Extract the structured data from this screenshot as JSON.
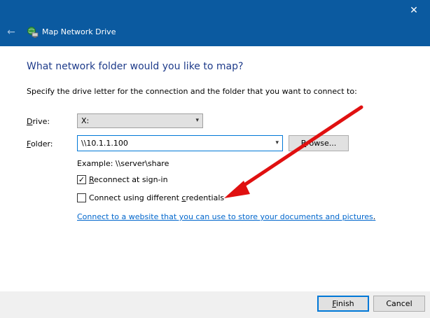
{
  "window": {
    "title": "Map Network Drive",
    "close_glyph": "✕",
    "back_glyph": "←"
  },
  "main": {
    "heading": "What network folder would you like to map?",
    "instruction": "Specify the drive letter for the connection and the folder that you want to connect to:",
    "drive": {
      "label_u": "D",
      "label_rest": "rive:",
      "value": "X:"
    },
    "folder": {
      "label_u": "F",
      "label_prefix": "",
      "label_rest": "older:",
      "value": "\\\\10.1.1.100"
    },
    "browse": {
      "label_u": "B",
      "label_rest": "rowse..."
    },
    "example": "Example: \\\\server\\share",
    "reconnect": {
      "checked": true,
      "label_u": "R",
      "label_rest": "econnect at sign-in"
    },
    "credentials": {
      "checked": false,
      "label_pre": "Connect using different ",
      "label_u": "c",
      "label_rest": "redentials"
    },
    "link": {
      "text": "Connect to a website that you can use to store your documents and pictures",
      "dot": "."
    }
  },
  "footer": {
    "finish_u": "F",
    "finish_rest": "inish",
    "cancel": "Cancel"
  },
  "colors": {
    "titlebar": "#0b5aa0",
    "heading": "#1e3b8a",
    "link": "#0066cc",
    "annotation_arrow": "#e01010"
  },
  "icons": {
    "chevron": "▾",
    "check": "✓"
  }
}
